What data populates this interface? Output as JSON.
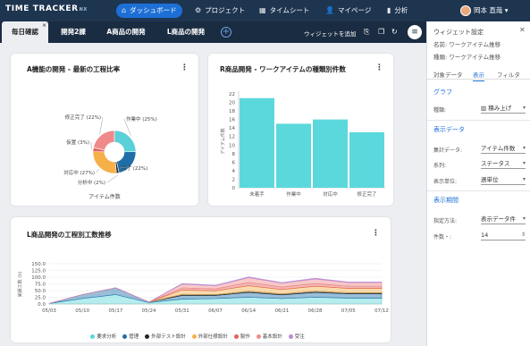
{
  "app": {
    "logo_text": "TIME TRACKER",
    "logo_suffix": "NX"
  },
  "nav": [
    {
      "label": "ダッシュボード",
      "icon": "dashboard-icon",
      "active": true
    },
    {
      "label": "プロジェクト",
      "icon": "project-icon"
    },
    {
      "label": "タイムシート",
      "icon": "timesheet-icon"
    },
    {
      "label": "マイページ",
      "icon": "mypage-icon"
    },
    {
      "label": "分析",
      "icon": "analysis-icon"
    }
  ],
  "user": {
    "name": "岡本 直哉"
  },
  "tabs": [
    "毎日確認",
    "開発2課",
    "A商品の開発",
    "L商品の開発"
  ],
  "toolbar": {
    "add_widget": "ウィジェットを追加"
  },
  "widgets": {
    "donut": {
      "title": "A機能の開発 - 最新の工程比率",
      "caption": "アイテム件数"
    },
    "bar": {
      "title": "R商品開発 - ワークアイテムの種類別件数"
    },
    "area": {
      "title": "L商品開発の工程別工数推移"
    }
  },
  "side": {
    "title": "ウィジェット設定",
    "name_label": "名前:",
    "name_value": "ワークアイテム推移",
    "type_label": "種類:",
    "type_value": "ワークアイテム推移",
    "tabs": [
      "対象データ",
      "表示",
      "フィルタ"
    ],
    "sec_graph": "グラフ",
    "kind_label": "種類:",
    "kind_value": "積み上げ",
    "sec_data": "表示データ",
    "agg_label": "集計データ:",
    "agg_value": "アイテム件数",
    "series_label": "系列:",
    "series_value": "ステータス",
    "unit_label": "表示単位:",
    "unit_value": "週単位",
    "sec_period": "表示期間",
    "method_label": "指定方法:",
    "method_value": "表示データ件",
    "count_label": "件数・:",
    "count_value": "14"
  },
  "chart_data": [
    {
      "type": "pie",
      "title": "A機能の開発 - 最新の工程比率",
      "xlabel": "アイテム件数",
      "slices": [
        {
          "label": "作業中 (25%)",
          "value": 25,
          "color": "#5ad0d8"
        },
        {
          "label": "完了 (22%)",
          "value": 22,
          "color": "#1f6ea8"
        },
        {
          "label": "分析中 (2%)",
          "value": 2,
          "color": "#2a2a2a"
        },
        {
          "label": "対応中 (27%)",
          "value": 27,
          "color": "#f5b04a"
        },
        {
          "label": "仮置 (3%)",
          "value": 3,
          "color": "#e3635c"
        },
        {
          "label": "修正完了 (22%)",
          "value": 22,
          "color": "#f08a8a"
        }
      ]
    },
    {
      "type": "bar",
      "title": "R商品開発 - ワークアイテムの種類別件数",
      "ylabel": "アイテム件数",
      "categories": [
        "未着手",
        "作業中",
        "対応中",
        "修正完了"
      ],
      "values": [
        21,
        15,
        16,
        13
      ],
      "ylim": [
        0,
        22
      ],
      "yticks": [
        0,
        2,
        4,
        6,
        8,
        10,
        12,
        14,
        16,
        18,
        20,
        22
      ],
      "color": "#5ad8dc"
    },
    {
      "type": "area",
      "title": "L商品開発の工程別工数推移",
      "ylabel": "実績工数 (h)",
      "x": [
        "05/03",
        "05/10",
        "05/17",
        "05/24",
        "05/31",
        "06/07",
        "06/14",
        "06/21",
        "06/28",
        "07/05",
        "07/12"
      ],
      "ylim": [
        0,
        150
      ],
      "yticks": [
        "0.0",
        "25.0",
        "50.0",
        "75.0",
        "100.0",
        "125.0",
        "150.0"
      ],
      "series": [
        {
          "name": "要求分析",
          "color": "#5ad8dc",
          "values": [
            2,
            20,
            35,
            5,
            18,
            20,
            25,
            20,
            25,
            22,
            22
          ]
        },
        {
          "name": "管理",
          "color": "#1f6ea8",
          "values": [
            0,
            15,
            25,
            2,
            14,
            12,
            18,
            14,
            18,
            16,
            16
          ]
        },
        {
          "name": "外部テスト設計",
          "color": "#222222",
          "values": [
            0,
            0,
            0,
            0,
            4,
            3,
            5,
            4,
            5,
            4,
            4
          ]
        },
        {
          "name": "外部仕様設計",
          "color": "#f5b04a",
          "values": [
            0,
            0,
            0,
            0,
            16,
            14,
            20,
            16,
            18,
            16,
            16
          ]
        },
        {
          "name": "製作",
          "color": "#e3635c",
          "values": [
            0,
            0,
            0,
            0,
            8,
            7,
            12,
            9,
            10,
            8,
            8
          ]
        },
        {
          "name": "基本設計",
          "color": "#f08a8a",
          "values": [
            0,
            0,
            0,
            0,
            14,
            12,
            18,
            15,
            17,
            14,
            14
          ]
        },
        {
          "name": "受注",
          "color": "#b98ad6",
          "values": [
            0,
            0,
            0,
            0,
            2,
            2,
            3,
            2,
            3,
            2,
            2
          ]
        }
      ]
    }
  ]
}
